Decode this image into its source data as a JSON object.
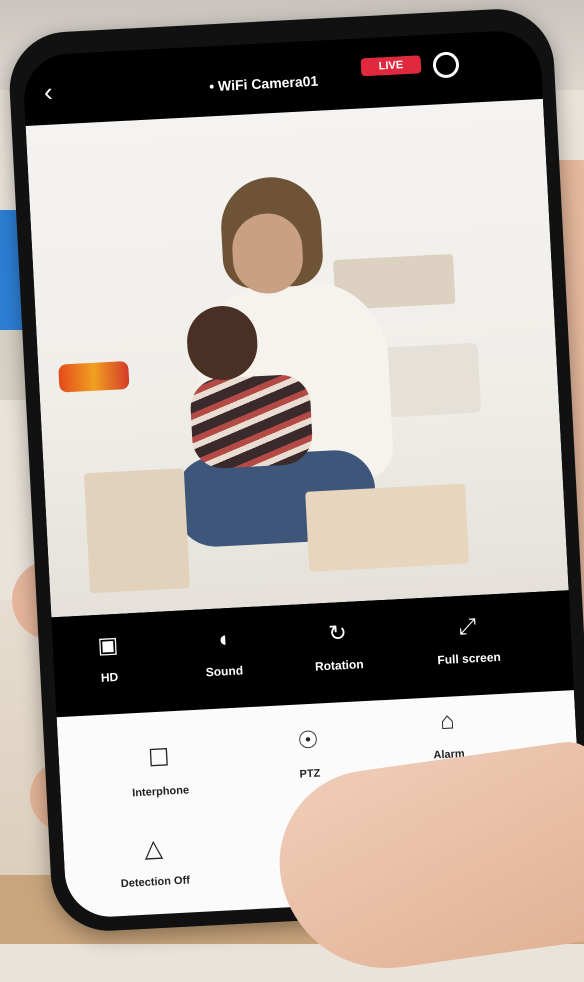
{
  "app": {
    "title": "• WiFi Camera01",
    "status_badge": "LIVE"
  },
  "header": {
    "back_icon": "chevron-left-icon",
    "settings_icon": "gear-icon"
  },
  "controls": [
    {
      "label": "HD",
      "icon": "hd-icon"
    },
    {
      "label": "Sound",
      "icon": "speaker-icon"
    },
    {
      "label": "Rotation",
      "icon": "rotate-icon"
    },
    {
      "label": "Full screen",
      "icon": "fullscreen-icon"
    }
  ],
  "panel": [
    {
      "label": "Interphone",
      "icon": "microphone-icon"
    },
    {
      "label": "PTZ",
      "icon": "ptz-icon"
    },
    {
      "label": "Alarm",
      "icon": "alarm-icon"
    },
    {
      "label": "Detection Off",
      "icon": "motion-icon"
    },
    {
      "label": "",
      "icon": "record-icon"
    }
  ],
  "colors": {
    "accent": "#e0293e",
    "screen_dark": "#000000",
    "panel_bg": "#fbfbfb"
  }
}
